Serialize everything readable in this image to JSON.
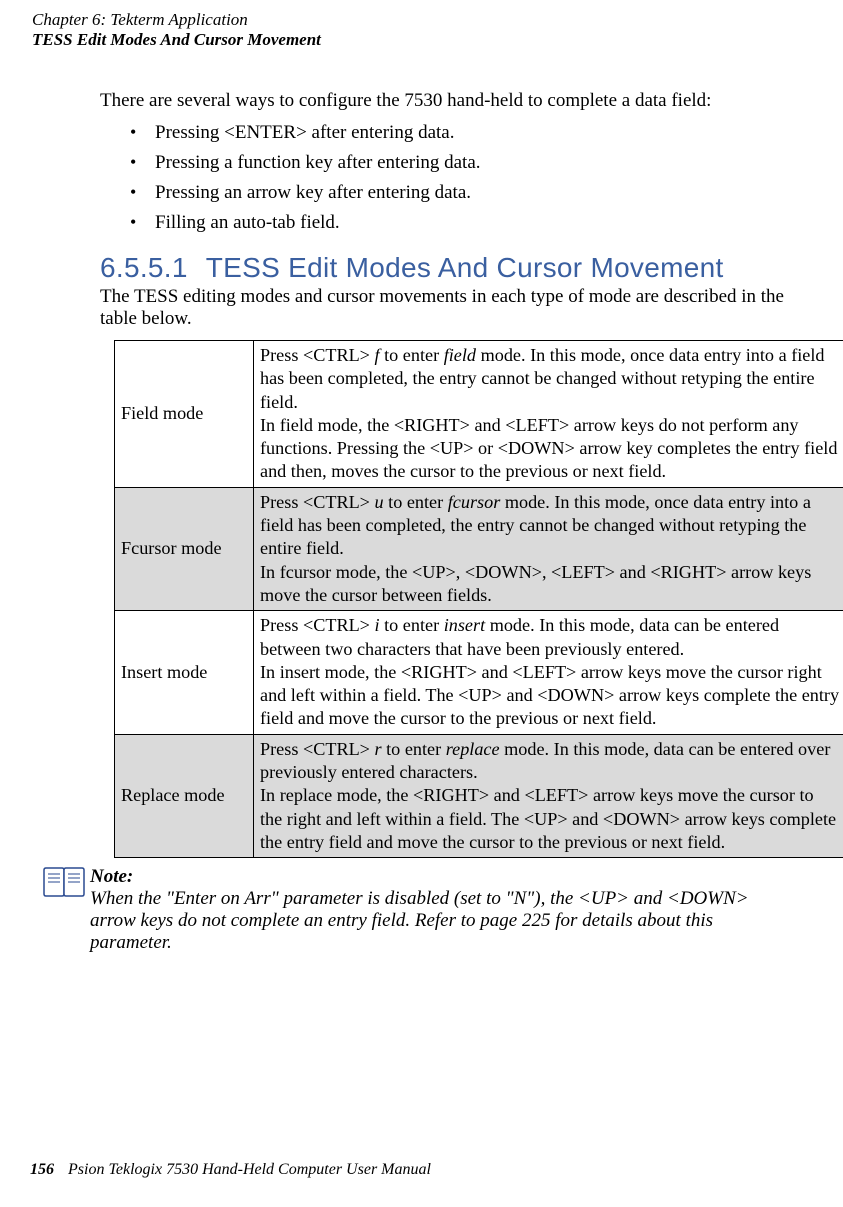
{
  "header": {
    "chapter": "Chapter 6: Tekterm Application",
    "section": "TESS Edit Modes And Cursor Movement"
  },
  "intro": "There are several ways to configure the 7530 hand-held to complete a data field:",
  "bullets": [
    "Pressing <ENTER> after entering data.",
    "Pressing a function key after entering data.",
    "Pressing an arrow key after entering data.",
    "Filling an auto-tab field."
  ],
  "heading": {
    "number": "6.5.5.1",
    "title": "TESS Edit Modes And Cursor Movement"
  },
  "tableIntro": "The TESS editing modes and cursor movements in each type of mode are described in the table below.",
  "table": [
    {
      "label": "Field mode",
      "pressPrefix": "Press  <CTRL> ",
      "key": "f",
      "enterPrefix": "  to enter ",
      "modeWord": "field",
      "afterMode": " mode. In this mode, once data entry into a field has been completed, the entry cannot be changed without retyping the entire field.",
      "secondPara": "In field mode, the <RIGHT> and <LEFT> arrow keys do not perform any functions. Pressing the <UP> or <DOWN> arrow key completes the entry field and then, moves the cursor to the previous or next field."
    },
    {
      "label": "Fcursor mode",
      "pressPrefix": "Press  <CTRL> ",
      "key": "u",
      "enterPrefix": "  to enter ",
      "modeWord": "fcursor",
      "afterMode": " mode. In this mode, once data entry into a field has been completed, the entry cannot be changed without retyping the entire field.",
      "secondPara": "In fcursor mode, the <UP>, <DOWN>, <LEFT> and <RIGHT> arrow keys move the cursor between fields."
    },
    {
      "label": "Insert mode",
      "pressPrefix": "Press  <CTRL> ",
      "key": "i",
      "enterPrefix": "  to enter ",
      "modeWord": "insert",
      "afterMode": " mode. In this mode, data can be entered between two characters that have been previously entered.",
      "secondPara": "In insert mode, the <RIGHT> and <LEFT> arrow keys move the cursor right and left within a field. The <UP> and <DOWN> arrow keys complete the entry field and move the cursor to the previous or next field."
    },
    {
      "label": "Replace mode",
      "pressPrefix": "Press  <CTRL> ",
      "key": "r",
      "enterPrefix": "  to enter ",
      "modeWord": "replace",
      "afterMode": " mode. In this mode, data can be entered over previously entered characters.",
      "secondPara": "In replace mode, the <RIGHT> and <LEFT> arrow keys move the cursor to the right and left within a field. The <UP> and <DOWN> arrow keys complete the entry field and move the cursor to the previous or next field."
    }
  ],
  "note": {
    "label": "Note:",
    "text": "When the \"Enter on Arr\" parameter is disabled (set to \"N\"), the <UP> and <DOWN> arrow keys do not complete an entry field. Refer to page 225 for details about this parameter."
  },
  "footer": {
    "page": "156",
    "title": "Psion Teklogix 7530 Hand-Held Computer User Manual"
  }
}
